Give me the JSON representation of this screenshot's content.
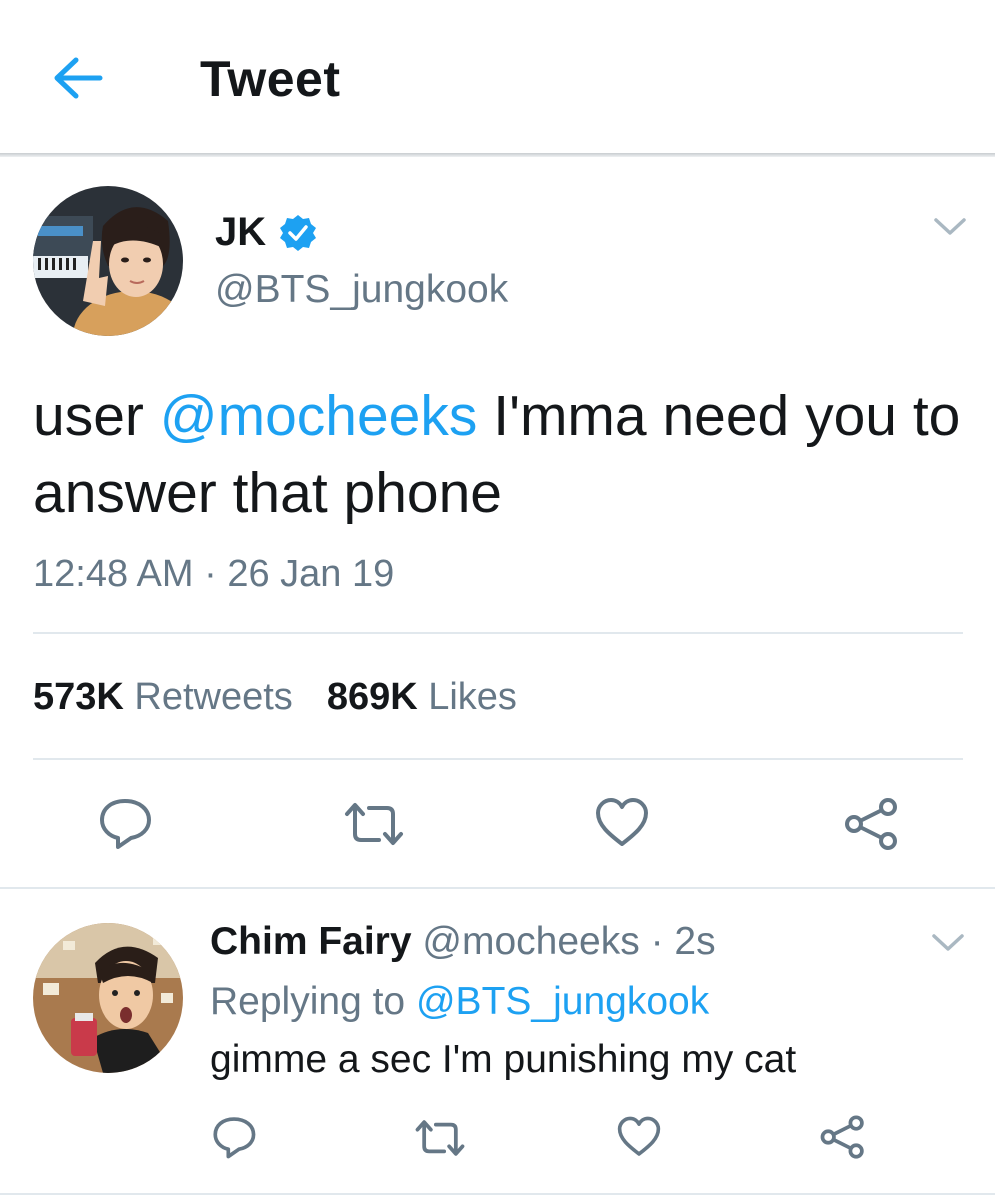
{
  "header": {
    "title": "Tweet",
    "back_icon": "arrow-left-icon",
    "accent": "#1da1f2"
  },
  "tweet": {
    "author_name": "JK",
    "verified_icon": "verified-badge-icon",
    "handle": "@BTS_jungkook",
    "text_before": "user ",
    "mention": "@mocheeks",
    "text_after": " I'mma need you to answer that phone",
    "timestamp": "12:48 AM · 26 Jan 19",
    "stats": {
      "retweets_count": "573K",
      "retweets_label": "Retweets",
      "likes_count": "869K",
      "likes_label": "Likes"
    },
    "actions": [
      "reply-icon",
      "retweet-icon",
      "like-icon",
      "share-icon"
    ]
  },
  "reply": {
    "author_name": "Chim Fairy",
    "handle": "@mocheeks",
    "time": " · 2s",
    "replying_label": "Replying to",
    "replying_to": "@BTS_jungkook",
    "text": "gimme a sec I'm punishing my cat"
  },
  "colors": {
    "text": "#14171a",
    "secondary": "#657786",
    "divider": "#e1e8ed",
    "link": "#1da1f2"
  }
}
